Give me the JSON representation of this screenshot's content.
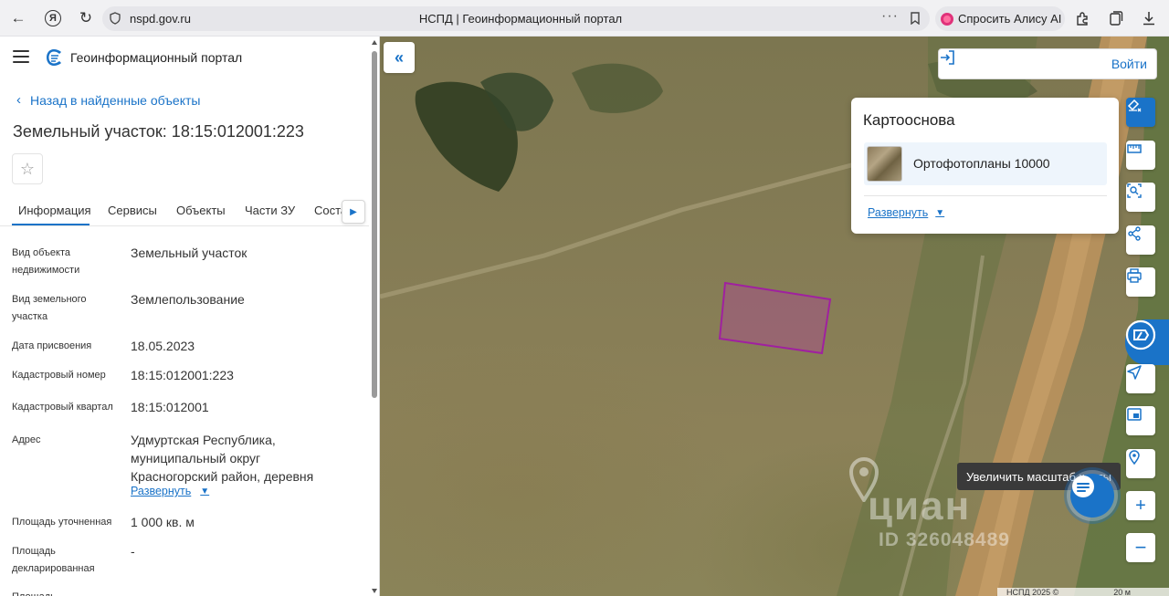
{
  "browser": {
    "url": "nspd.gov.ru",
    "page_title": "НСПД | Геоинформационный портал",
    "alice_label": "Спросить Алису AI"
  },
  "panel": {
    "portal_name": "Геоинформационный портал",
    "back_label": "Назад в найденные объекты",
    "object_title": "Земельный участок: 18:15:012001:223",
    "tabs": [
      "Информация",
      "Сервисы",
      "Объекты",
      "Части ЗУ",
      "Состав"
    ],
    "properties": [
      {
        "label": "Вид объекта недвижимости",
        "value": "Земельный участок"
      },
      {
        "label": "Вид земельного участка",
        "value": "Землепользование"
      },
      {
        "label": "Дата присвоения",
        "value": "18.05.2023"
      },
      {
        "label": "Кадастровый номер",
        "value": "18:15:012001:223"
      },
      {
        "label": "Кадастровый квартал",
        "value": "18:15:012001"
      },
      {
        "label": "Адрес",
        "value": "Удмуртская Республика, муниципальный округ Красногорский район, деревня"
      },
      {
        "label": "Площадь уточненная",
        "value": "1 000 кв. м"
      },
      {
        "label": "Площадь декларированная",
        "value": "-"
      },
      {
        "label": "Площадь",
        "value": ""
      }
    ],
    "expand_label": "Развернуть"
  },
  "map": {
    "login_label": "Войти",
    "basemap_title": "Картооснова",
    "basemap_layer": "Ортофотопланы 10000",
    "basemap_expand": "Развернуть",
    "zoom_tooltip": "Увеличить масштаб карты",
    "watermark_brand": "циан",
    "watermark_id": "ID 326048489",
    "attribution": "НСПД 2025 ©",
    "scale": "20 м"
  },
  "colors": {
    "accent": "#1a73c8",
    "parcel_stroke": "#a020a0",
    "parcel_fill": "#b0409a"
  }
}
